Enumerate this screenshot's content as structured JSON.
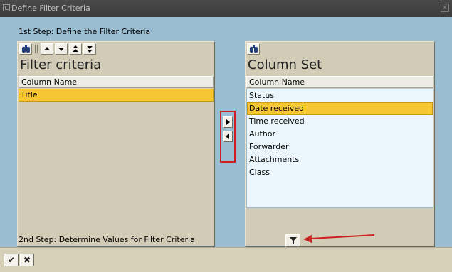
{
  "window": {
    "title": "Define Filter Criteria"
  },
  "step1_label": "1st Step: Define the Filter Criteria",
  "left_panel": {
    "title": "Filter criteria",
    "column_header": "Column Name",
    "rows": [
      {
        "label": "Title",
        "selected": true
      }
    ],
    "toolbar_icons": [
      "find-icon",
      "move-up-icon",
      "move-down-icon",
      "move-top-icon",
      "move-bottom-icon"
    ]
  },
  "right_panel": {
    "title": "Column Set",
    "column_header": "Column Name",
    "rows": [
      {
        "label": "Status",
        "selected": false
      },
      {
        "label": "Date received",
        "selected": true
      },
      {
        "label": "Time received",
        "selected": false
      },
      {
        "label": "Author",
        "selected": false
      },
      {
        "label": "Forwarder",
        "selected": false
      },
      {
        "label": "Attachments",
        "selected": false
      },
      {
        "label": "Class",
        "selected": false
      }
    ],
    "toolbar_icons": [
      "find-icon"
    ]
  },
  "move_buttons": [
    "move-right-icon",
    "move-left-icon"
  ],
  "step2_label": "2nd Step: Determine Values for Filter Criteria",
  "filter_button_icon": "filter-funnel-icon",
  "footer": {
    "ok_symbol": "✔",
    "cancel_symbol": "✖"
  },
  "colors": {
    "dialog_background": "#9bbdd2",
    "panel_background": "#d2cbb6",
    "selection": "#f7c633",
    "highlight_box": "#cc2222",
    "annotation_arrow": "#cc2222"
  }
}
